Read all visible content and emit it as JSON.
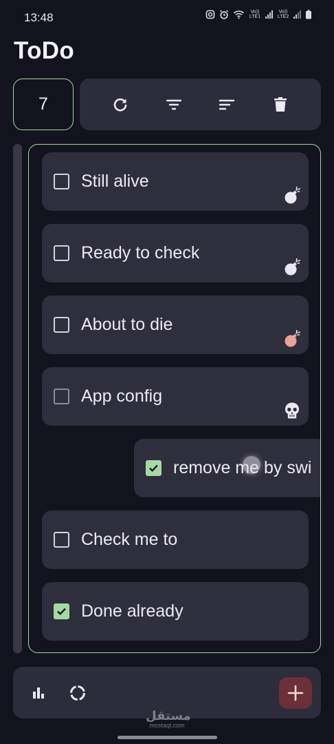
{
  "status_bar": {
    "time": "13:48",
    "sim1_label": "Vo)) LTE1",
    "sim2_label": "Vo)) LTE2",
    "icons": [
      "instagram-icon",
      "alarm-icon",
      "wifi-icon",
      "signal-icon",
      "battery-icon"
    ]
  },
  "app": {
    "title": "ToDo"
  },
  "counter": {
    "value": "7"
  },
  "toolbar": {
    "buttons": [
      "refresh-icon",
      "filter-icon",
      "sort-icon",
      "delete-icon"
    ]
  },
  "tasks": [
    {
      "label": "Still alive",
      "checked": false,
      "status_icon": "bomb-icon",
      "icon_color": "#e9e7f0"
    },
    {
      "label": "Ready to check",
      "checked": false,
      "status_icon": "bomb-icon",
      "icon_color": "#e9e7f0"
    },
    {
      "label": "About to die",
      "checked": false,
      "status_icon": "bomb-icon",
      "icon_color": "#e9a29a"
    },
    {
      "label": "App config",
      "checked": false,
      "status_icon": "skull-icon",
      "icon_color": "#e9e7f0"
    },
    {
      "label": "remove me by swi",
      "checked": true,
      "status_icon": "",
      "icon_color": ""
    },
    {
      "label": "Check me to",
      "checked": false,
      "status_icon": "",
      "icon_color": ""
    },
    {
      "label": "Done already",
      "checked": true,
      "status_icon": "",
      "icon_color": ""
    }
  ],
  "bottom_bar": {
    "buttons": [
      "stats-icon",
      "progress-ring-icon"
    ],
    "fab_icon": "plus-icon"
  },
  "watermark": {
    "main": "مستقل",
    "sub": "mostaql.com"
  },
  "colors": {
    "background": "#13131d",
    "card": "#2f2e3c",
    "accent_green": "#a6d8a4",
    "fab": "#6b2f38",
    "danger_icon": "#e9a29a"
  }
}
